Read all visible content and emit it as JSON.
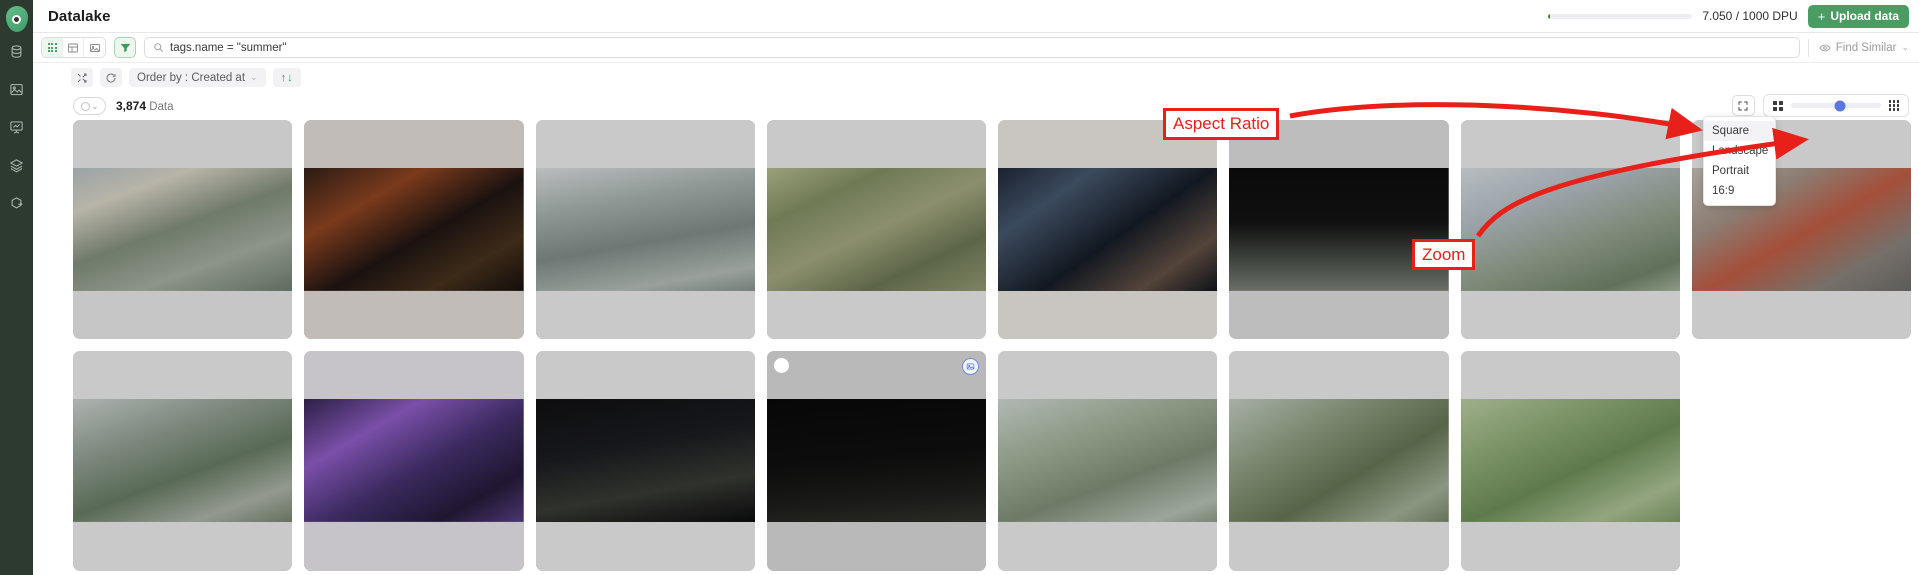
{
  "app": {
    "title": "Datalake"
  },
  "sidebar": {
    "logo_name": "datalake-logo",
    "items": [
      {
        "icon": "database-icon",
        "label": "Datalake"
      },
      {
        "icon": "image-icon",
        "label": "Images"
      },
      {
        "icon": "analytics-board-icon",
        "label": "Analytics"
      },
      {
        "icon": "layers-icon",
        "label": "Layers"
      },
      {
        "icon": "box-export-icon",
        "label": "Export"
      }
    ]
  },
  "header": {
    "dpu_text": "7.050 / 1000 DPU",
    "dpu_used": 7.05,
    "dpu_total": 1000,
    "upload_label": "Upload data",
    "upload_plus": "+",
    "upload_color": "#4a9c62"
  },
  "toolbar": {
    "view_modes": [
      {
        "name": "grid-view",
        "icon": "dot-grid-icon",
        "active": true
      },
      {
        "name": "table-view",
        "icon": "table-icon",
        "active": false
      },
      {
        "name": "image-view",
        "icon": "image-icon",
        "active": false
      }
    ],
    "filter_icon": "funnel-icon",
    "search": {
      "value": "tags.name = \"summer\"",
      "placeholder": "Search",
      "icon": "search-icon"
    },
    "find_similar": {
      "label": "Find Similar",
      "icon": "eye-icon",
      "chevron": "⌄"
    }
  },
  "toolbar2": {
    "shuffle_icon": "shuffle-icon",
    "refresh_icon": "refresh-icon",
    "order_by_label": "Order by : Created at",
    "order_chevron": "⌄",
    "sort_up": "↑",
    "sort_down": "↓"
  },
  "count_row": {
    "select_chevron": "⌄",
    "count": "3,874",
    "count_suffix": " Data"
  },
  "view_controls": {
    "aspect_ratio_icon": "aspect-ratio-icon",
    "zoom_small_icon": "grid-2x2-icon",
    "zoom_large_icon": "grid-3x3-icon",
    "zoom_value": 55
  },
  "aspect_menu": {
    "items": [
      {
        "label": "Square",
        "selected": true
      },
      {
        "label": "Landscape",
        "selected": false
      },
      {
        "label": "Portrait",
        "selected": false
      },
      {
        "label": "16:9",
        "selected": false
      }
    ]
  },
  "annotations": [
    {
      "name": "aspect-ratio-annotation",
      "text": "Aspect Ratio",
      "color": "#e8201a"
    },
    {
      "name": "zoom-annotation",
      "text": "Zoom",
      "color": "#e8201a"
    }
  ],
  "grid": {
    "tiles": [
      {
        "id": 1,
        "scene": "aerial daytime street with shops",
        "top": "#c8c8c8",
        "bot": "#c6c6c6",
        "img": "linear-gradient(160deg,#9aa3a6 0%,#b8b4a8 22%,#6f7a6a 48%,#8d9488 72%,#5f6b60 100%)"
      },
      {
        "id": 2,
        "scene": "aerial night street orange lights",
        "top": "#c2bcb8",
        "bot": "#c2bcb8",
        "img": "linear-gradient(150deg,#2a1b14 0%,#7a3a1c 28%,#1a1210 55%,#3d2a18 78%,#120d0b 100%)"
      },
      {
        "id": 3,
        "scene": "aerial intersection with cars day",
        "top": "#c9c9c9",
        "bot": "#c9c9c9",
        "img": "linear-gradient(170deg,#b9bdbd 0%,#8e9794 30%,#6d7773 58%,#9aa19d 85%,#747d78 100%)"
      },
      {
        "id": 4,
        "scene": "aerial rooftop market daytime",
        "top": "#c9c9c9",
        "bot": "#c9c9c9",
        "img": "linear-gradient(155deg,#9aa07a 0%,#6f7a55 25%,#8c8f6e 50%,#5c6647 75%,#7e8463 100%)"
      },
      {
        "id": 5,
        "scene": "night crossroad with traffic lights",
        "top": "#c9c6c2",
        "bot": "#c9c6c2",
        "img": "linear-gradient(145deg,#1a2230 0%,#3c4a5e 25%,#121820 55%,#54443a 80%,#0e1218 100%)"
      },
      {
        "id": 6,
        "scene": "dark overpass night empty",
        "top": "#bdbdbd",
        "bot": "#bdbdbd",
        "img": "linear-gradient(180deg,#0a0a0a 0%,#101010 45%,#3a3f3a 72%,#6a7068 100%)"
      },
      {
        "id": 7,
        "scene": "aerial apartment towers daytime",
        "top": "#c9c9c9",
        "bot": "#c9c9c9",
        "img": "linear-gradient(160deg,#b7bcc0 0%,#9aa3a8 30%,#7d8a78 60%,#60705a 85%,#8d9a86 100%)"
      },
      {
        "id": 8,
        "scene": "aerial street with red storefronts",
        "top": "#c9c9c9",
        "bot": "#c9c9c9",
        "img": "linear-gradient(150deg,#a8a39c 0%,#8c7d72 28%,#a44f3a 52%,#76706a 78%,#5c5b58 100%)"
      },
      {
        "id": 9,
        "scene": "aerial highway bridge with trucks",
        "top": "#c9c9c9",
        "bot": "#c9c9c9",
        "img": "linear-gradient(160deg,#aeb3b0 0%,#7f8a80 30%,#586a55 58%,#93998f 82%,#66705f 100%)"
      },
      {
        "id": 10,
        "scene": "purple night aerial with trees",
        "top": "#c6c4c8",
        "bot": "#c6c4c8",
        "img": "linear-gradient(150deg,#2b1f46 0%,#7a4fa8 28%,#3a2a5e 55%,#1f1630 80%,#4a3570 100%)"
      },
      {
        "id": 11,
        "scene": "dark night road aerial",
        "top": "#c9c9c9",
        "bot": "#c9c9c9",
        "img": "linear-gradient(170deg,#0d0d0f 0%,#17181c 40%,#30322c 70%,#0a0a0c 100%)"
      },
      {
        "id": 12,
        "scene": "night intersection car headlights",
        "top": "#b9b9b9",
        "bot": "#b9b9b9",
        "img": "linear-gradient(175deg,#070707 0%,#0d0d0d 50%,#1a1a18 78%,#2a2a26 100%)"
      },
      {
        "id": 13,
        "scene": "aerial residential blocks day",
        "top": "#c9c9c9",
        "bot": "#c9c9c9",
        "img": "linear-gradient(160deg,#b2b8b4 0%,#8d9a86 32%,#6d7a66 62%,#9ba59a 88%,#7b8574 100%)"
      },
      {
        "id": 14,
        "scene": "aerial overpass with greenery",
        "top": "#c9c9c9",
        "bot": "#c9c9c9",
        "img": "linear-gradient(150deg,#a8afa6 0%,#7c8a72 30%,#566448 60%,#8b9680 85%,#65725a 100%)"
      },
      {
        "id": 15,
        "scene": "aerial village fields daytime",
        "top": "#c9c9c9",
        "bot": "#c9c9c9",
        "img": "linear-gradient(155deg,#9fb08c 0%,#7d9468 28%,#5e7a4c 56%,#93a57f 82%,#6d8459 100%)"
      }
    ],
    "hovered_tile_index": 11,
    "hover_badge_icon": "image-badge-icon"
  }
}
